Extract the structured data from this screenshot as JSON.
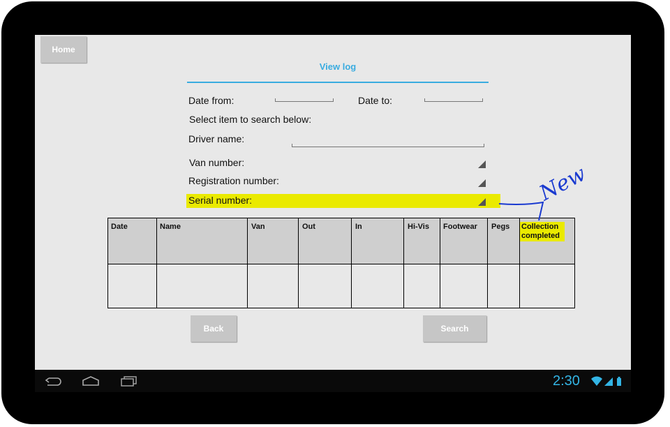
{
  "home_label": "Home",
  "title": "View log",
  "filters": {
    "date_from": "Date from:",
    "date_to": "Date to:",
    "select_prompt": "Select item to search below:",
    "driver_name": "Driver name:",
    "van_number": "Van number:",
    "registration_number": "Registration number:",
    "serial_number": "Serial number:"
  },
  "table": {
    "columns": [
      "Date",
      "Name",
      "Van",
      "Out",
      "In",
      "Hi-Vis",
      "Footwear",
      "Pegs",
      "Collection completed"
    ],
    "rows": [
      [
        "",
        "",
        "",
        "",
        "",
        "",
        "",
        "",
        ""
      ]
    ]
  },
  "buttons": {
    "back": "Back",
    "search": "Search"
  },
  "annotation": "New",
  "status_bar": {
    "time": "2:30"
  },
  "colors": {
    "accent": "#3aace0",
    "highlight": "#eaea00",
    "annotation": "#1a3ad0"
  }
}
